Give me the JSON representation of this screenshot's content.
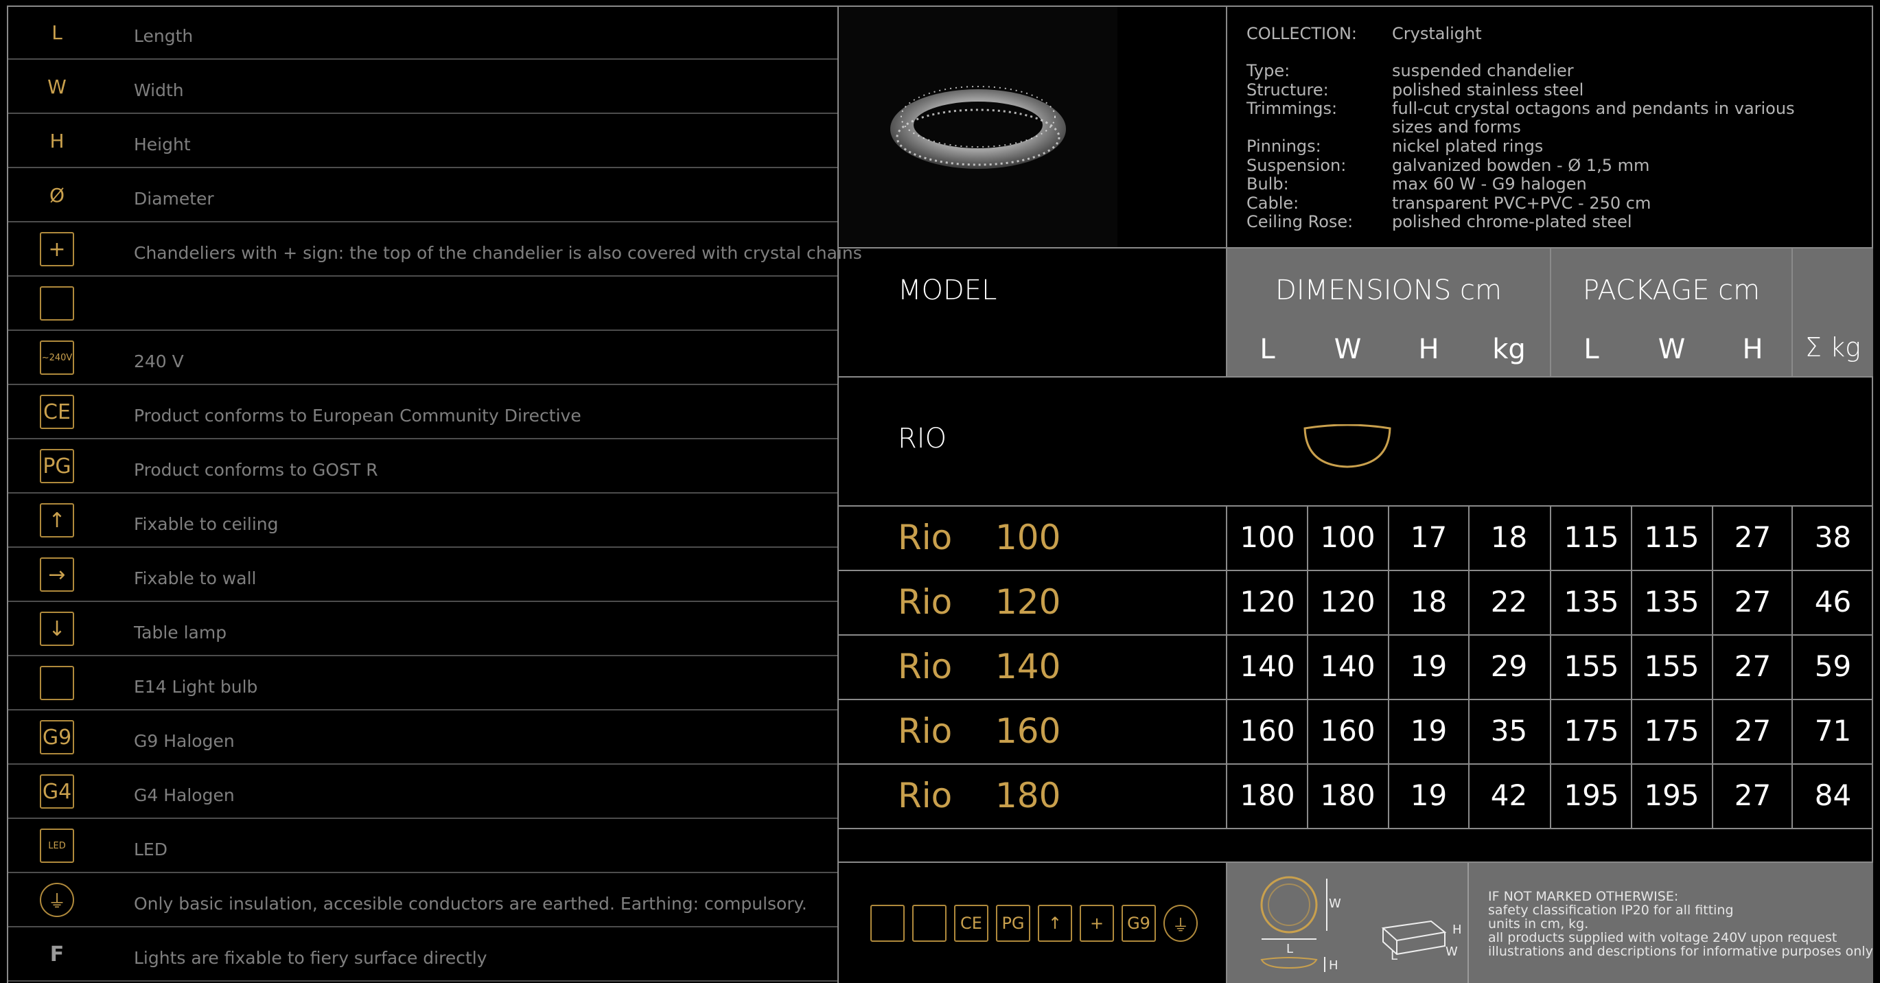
{
  "legend": [
    {
      "symbol": "L",
      "icon": "length-letter-icon",
      "label": "Length"
    },
    {
      "symbol": "W",
      "icon": "width-letter-icon",
      "label": "Width"
    },
    {
      "symbol": "H",
      "icon": "height-letter-icon",
      "label": "Height"
    },
    {
      "symbol": "Ø",
      "icon": "diameter-icon",
      "label": "Diameter"
    },
    {
      "symbol": "+",
      "icon": "plus-sign-icon",
      "label": "Chandeliers with + sign: the top of the chandelier is also covered with crystal chains"
    },
    {
      "symbol": "",
      "icon": "empty-box-icon",
      "label": ""
    },
    {
      "symbol": "~240V",
      "icon": "voltage-240v-icon",
      "label": "240 V"
    },
    {
      "symbol": "CE",
      "icon": "ce-mark-icon",
      "label": "Product conforms to European Community Directive"
    },
    {
      "symbol": "PG",
      "icon": "gost-r-icon",
      "label": "Product conforms to GOST R"
    },
    {
      "symbol": "↑",
      "icon": "ceiling-mount-icon",
      "label": "Fixable to ceiling"
    },
    {
      "symbol": "→",
      "icon": "wall-mount-icon",
      "label": "Fixable to wall"
    },
    {
      "symbol": "↓",
      "icon": "table-lamp-icon",
      "label": "Table lamp"
    },
    {
      "symbol": "",
      "icon": "e14-bulb-icon",
      "label": "E14 Light bulb"
    },
    {
      "symbol": "G9",
      "icon": "g9-halogen-icon",
      "label": "G9 Halogen"
    },
    {
      "symbol": "G4",
      "icon": "g4-halogen-icon",
      "label": "G4 Halogen"
    },
    {
      "symbol": "LED",
      "icon": "led-icon",
      "label": "LED"
    },
    {
      "symbol": "⏚",
      "icon": "earth-ground-icon",
      "label": "Only basic insulation, accesible conductors are earthed. Earthing: compulsory."
    },
    {
      "symbol": "F",
      "icon": "fiery-surface-icon",
      "label": "Lights are fixable to fiery surface directly"
    }
  ],
  "specs": [
    {
      "key": "COLLECTION:",
      "value": "Crystalight"
    },
    {
      "key": "Type:",
      "value": "suspended  chandelier"
    },
    {
      "key": "Structure:",
      "value": "polished stainless steel"
    },
    {
      "key": "Trimmings:",
      "value": "full-cut crystal octagons and pendants in various sizes and forms"
    },
    {
      "key": "Pinnings:",
      "value": "nickel plated rings"
    },
    {
      "key": "Suspension:",
      "value": "galvanized bowden - Ø 1,5 mm"
    },
    {
      "key": "Bulb:",
      "value": "max 60 W - G9 halogen"
    },
    {
      "key": "Cable:",
      "value": "transparent PVC+PVC - 250 cm"
    },
    {
      "key": "Ceiling Rose:",
      "value": "polished chrome-plated steel"
    }
  ],
  "table": {
    "model_header": "MODEL",
    "dimensions_header": "DIMENSIONS cm",
    "package_header": "PACKAGE cm",
    "weight_header": "Σ kg",
    "sub_headers": [
      "L",
      "W",
      "H",
      "kg",
      "L",
      "W",
      "H"
    ],
    "family": "RIO",
    "rows": [
      {
        "name": "Rio",
        "size": "100",
        "values": [
          "100",
          "100",
          "17",
          "18",
          "115",
          "115",
          "27",
          "38"
        ]
      },
      {
        "name": "Rio",
        "size": "120",
        "values": [
          "120",
          "120",
          "18",
          "22",
          "135",
          "135",
          "27",
          "46"
        ]
      },
      {
        "name": "Rio",
        "size": "140",
        "values": [
          "140",
          "140",
          "19",
          "29",
          "155",
          "155",
          "27",
          "59"
        ]
      },
      {
        "name": "Rio",
        "size": "160",
        "values": [
          "160",
          "160",
          "19",
          "35",
          "175",
          "175",
          "27",
          "71"
        ]
      },
      {
        "name": "Rio",
        "size": "180",
        "values": [
          "180",
          "180",
          "19",
          "42",
          "195",
          "195",
          "27",
          "84"
        ]
      }
    ]
  },
  "diagram_labels": {
    "w": "W",
    "l": "L",
    "h": "H",
    "box_h": "H",
    "box_l": "L",
    "box_w": "W"
  },
  "notes": [
    "IF NOT MARKED OTHERWISE:",
    "safety classification IP20 for all fitting",
    "units in cm, kg.",
    "all products supplied with voltage 240V upon request",
    "illustrations and descriptions for informative purposes only"
  ],
  "colors": {
    "gold": "#c9a04d",
    "gray_panel": "#6e6e6e",
    "line": "#8a8a8a"
  }
}
